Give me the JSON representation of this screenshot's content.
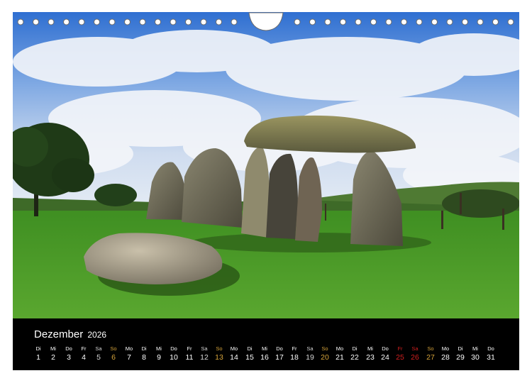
{
  "calendar": {
    "month": "Dezember",
    "year": "2026",
    "days": [
      {
        "wd": "Di",
        "d": "1",
        "type": "weekday"
      },
      {
        "wd": "Mi",
        "d": "2",
        "type": "weekday"
      },
      {
        "wd": "Do",
        "d": "3",
        "type": "weekday"
      },
      {
        "wd": "Fr",
        "d": "4",
        "type": "weekday"
      },
      {
        "wd": "Sa",
        "d": "5",
        "type": "sat"
      },
      {
        "wd": "So",
        "d": "6",
        "type": "sun"
      },
      {
        "wd": "Mo",
        "d": "7",
        "type": "weekday"
      },
      {
        "wd": "Di",
        "d": "8",
        "type": "weekday"
      },
      {
        "wd": "Mi",
        "d": "9",
        "type": "weekday"
      },
      {
        "wd": "Do",
        "d": "10",
        "type": "weekday"
      },
      {
        "wd": "Fr",
        "d": "11",
        "type": "weekday"
      },
      {
        "wd": "Sa",
        "d": "12",
        "type": "sat"
      },
      {
        "wd": "So",
        "d": "13",
        "type": "sun"
      },
      {
        "wd": "Mo",
        "d": "14",
        "type": "weekday"
      },
      {
        "wd": "Di",
        "d": "15",
        "type": "weekday"
      },
      {
        "wd": "Mi",
        "d": "16",
        "type": "weekday"
      },
      {
        "wd": "Do",
        "d": "17",
        "type": "weekday"
      },
      {
        "wd": "Fr",
        "d": "18",
        "type": "weekday"
      },
      {
        "wd": "Sa",
        "d": "19",
        "type": "sat"
      },
      {
        "wd": "So",
        "d": "20",
        "type": "sun"
      },
      {
        "wd": "Mo",
        "d": "21",
        "type": "weekday"
      },
      {
        "wd": "Di",
        "d": "22",
        "type": "weekday"
      },
      {
        "wd": "Mi",
        "d": "23",
        "type": "weekday"
      },
      {
        "wd": "Do",
        "d": "24",
        "type": "weekday"
      },
      {
        "wd": "Fr",
        "d": "25",
        "type": "hol"
      },
      {
        "wd": "Sa",
        "d": "26",
        "type": "hol"
      },
      {
        "wd": "So",
        "d": "27",
        "type": "sun"
      },
      {
        "wd": "Mo",
        "d": "28",
        "type": "weekday"
      },
      {
        "wd": "Di",
        "d": "29",
        "type": "weekday"
      },
      {
        "wd": "Mi",
        "d": "30",
        "type": "weekday"
      },
      {
        "wd": "Do",
        "d": "31",
        "type": "weekday"
      }
    ]
  },
  "colors": {
    "calendar_bg": "#000000",
    "weekday": "#ffffff",
    "saturday": "#d7d7d7",
    "sunday": "#d4a23a",
    "holiday": "#d21f1f"
  },
  "icons": {
    "binding": "spiral-binding-holes"
  }
}
